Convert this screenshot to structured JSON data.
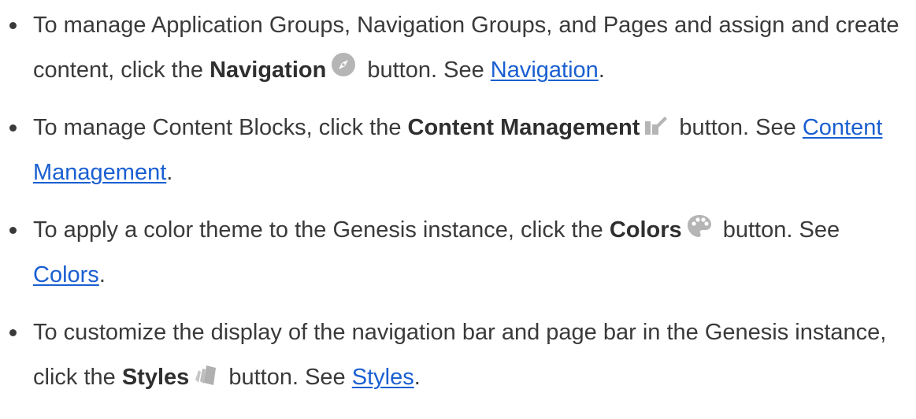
{
  "items": [
    {
      "before": "To manage Application Groups, Navigation Groups, and Pages and assign and create content, click the ",
      "bold": "Navigation",
      "after": " button. See ",
      "link": "Navigation",
      "end": ".",
      "icon": "compass-icon"
    },
    {
      "before": "To manage Content Blocks, click the ",
      "bold": "Content Management",
      "after": " button. See ",
      "link": "Content Management",
      "end": ".",
      "icon": "content-management-icon"
    },
    {
      "before": "To apply a color theme to the Genesis instance, click the ",
      "bold": "Colors",
      "after": " button. See ",
      "link": "Colors",
      "end": ".",
      "icon": "palette-icon"
    },
    {
      "before": "To customize the display of the navigation bar and page bar in the Genesis instance, click the ",
      "bold": "Styles",
      "after": " button. See ",
      "link": "Styles",
      "end": ".",
      "icon": "styles-icon"
    }
  ],
  "colors": {
    "text": "#3a3a3a",
    "link": "#1a5fd1",
    "icon": "#b5b5b5"
  }
}
